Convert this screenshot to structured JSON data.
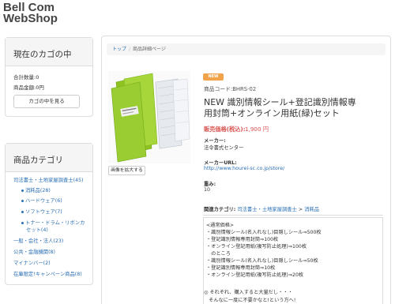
{
  "site": {
    "title_line1": "Bell Com",
    "title_line2": "WebShop"
  },
  "cart": {
    "heading": "現在のカゴの中",
    "total_qty": "合計数量:0",
    "total_amount": "商品金額:0円",
    "view_button": "カゴの中を見る"
  },
  "categories": {
    "heading": "商品カテゴリ",
    "items": [
      {
        "label": "司法書士・土地家屋調査士(45)"
      },
      {
        "label": "消耗品(28)"
      },
      {
        "label": "ハードウェア(6)"
      },
      {
        "label": "ソフトウェア(7)"
      },
      {
        "label": "トナー・ドラム・リボンカ"
      },
      {
        "label": "セット(4)"
      },
      {
        "label": "一般・会社・法人(23)"
      },
      {
        "label": "公共・金融機関(8)"
      },
      {
        "label": "マイナンバー(2)"
      },
      {
        "label": "在庫限定!キャンペーン商品(8)"
      }
    ]
  },
  "breadcrumb": {
    "home": "トップ",
    "separator": "/",
    "current": "商品詳細ページ"
  },
  "product": {
    "badge": "NEW",
    "code": "商品コード:BHRS-02",
    "name": "NEW 識別情報シール+登記識別情報専用封筒+オンライン用紙(緑)セット",
    "price_label": "販売価格(税込):",
    "price_value": "1,900 円",
    "maker_label": "メーカー:",
    "maker_value": "法令書式センター",
    "maker_url_label": "メーカーURL:",
    "maker_url_value": "http://www.hourei-sc.co.jp/store/",
    "weight_label": "重み:",
    "weight_value": "10",
    "related_label": "関連カテゴリ:",
    "related_link1": "司法書士・土地家屋調査士",
    "related_sep": ">",
    "related_link2": "消耗品",
    "zoom_button": "画像を拡大する"
  },
  "description": [
    "<通常価格>",
    "・識別情報シール(名入れなし)目隠しシール⇒500枚",
    "・登記識別情報専用封筒⇒100枚",
    "・オンライン登記用紙(複写防止処理)⇒100枚",
    "　のところ",
    "・識別情報シール(名入れなし)目隠しシール⇒50枚",
    "・登記識別情報専用封筒⇒10枚",
    "・オンライン登記用紙(複写防止処理)⇒20枚"
  ],
  "note": [
    "◎ それぞれ、購入すると大量だし・・・",
    "　そんなに一度に不要かなと!という方へ!"
  ],
  "colors": {
    "link": "#2a6fb5",
    "price": "#d9534f",
    "badge": "#f0a34a",
    "folder": "#9acd32"
  }
}
